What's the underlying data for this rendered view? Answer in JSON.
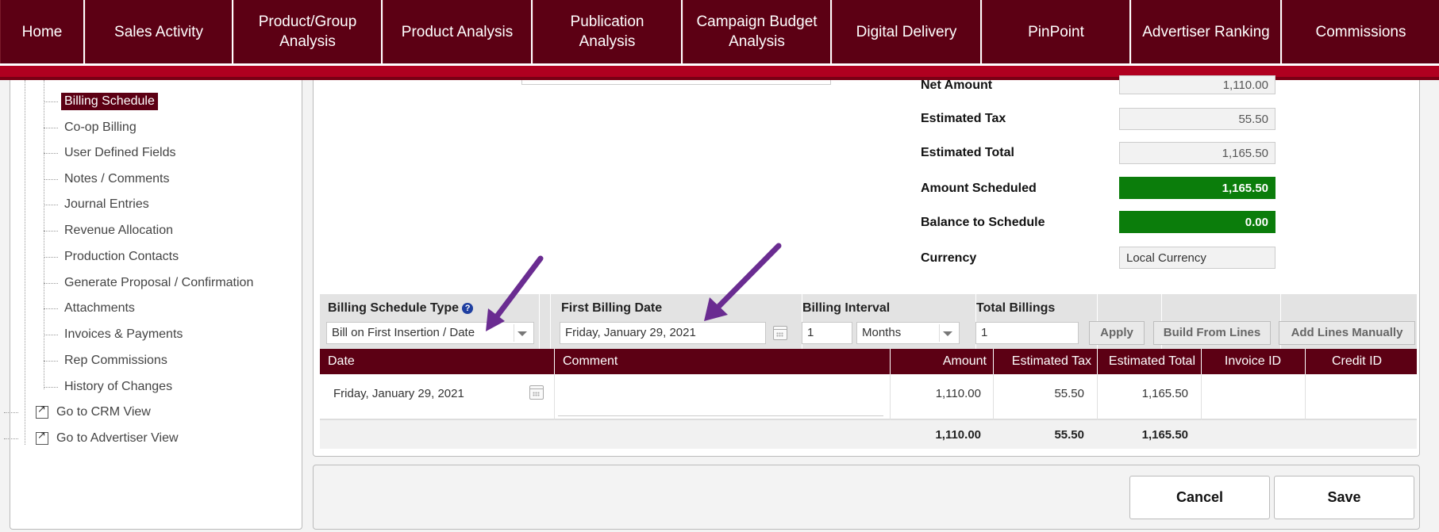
{
  "nav": {
    "tabs": [
      {
        "label": "Home"
      },
      {
        "label": "Sales Activity"
      },
      {
        "label": "Product/Group Analysis"
      },
      {
        "label": "Product Analysis"
      },
      {
        "label": "Publication Analysis"
      },
      {
        "label": "Campaign Budget Analysis"
      },
      {
        "label": "Digital Delivery"
      },
      {
        "label": "PinPoint"
      },
      {
        "label": "Advertiser Ranking"
      },
      {
        "label": "Commissions"
      }
    ]
  },
  "sidebar": {
    "items": [
      {
        "label": "Billing Schedule",
        "selected": true
      },
      {
        "label": "Co-op Billing"
      },
      {
        "label": "User Defined Fields"
      },
      {
        "label": "Notes / Comments"
      },
      {
        "label": "Journal Entries"
      },
      {
        "label": "Revenue Allocation"
      },
      {
        "label": "Production Contacts"
      },
      {
        "label": "Generate Proposal / Confirmation"
      },
      {
        "label": "Attachments"
      },
      {
        "label": "Invoices & Payments"
      },
      {
        "label": "Rep Commissions"
      },
      {
        "label": "History of Changes"
      }
    ],
    "links": [
      {
        "label": "Go to CRM View"
      },
      {
        "label": "Go to Advertiser View"
      }
    ]
  },
  "summary": {
    "net_amount": {
      "label": "Net Amount",
      "value": "1,110.00"
    },
    "estimated_tax": {
      "label": "Estimated Tax",
      "value": "55.50"
    },
    "estimated_total": {
      "label": "Estimated Total",
      "value": "1,165.50"
    },
    "amount_scheduled": {
      "label": "Amount Scheduled",
      "value": "1,165.50",
      "color": "#0b7d0b"
    },
    "balance_to_schedule": {
      "label": "Balance to Schedule",
      "value": "0.00",
      "color": "#0b7d0b"
    },
    "currency": {
      "label": "Currency",
      "value": "Local Currency"
    }
  },
  "controls": {
    "billing_schedule_type": {
      "label": "Billing Schedule Type",
      "value": "Bill on First Insertion / Date"
    },
    "first_billing_date": {
      "label": "First Billing Date",
      "value": "Friday, January 29, 2021"
    },
    "billing_interval": {
      "label": "Billing Interval",
      "value": "1",
      "unit": "Months"
    },
    "total_billings": {
      "label": "Total Billings",
      "value": "1"
    },
    "apply_label": "Apply",
    "build_from_lines_label": "Build From Lines",
    "add_lines_manually_label": "Add Lines Manually"
  },
  "grid": {
    "columns": [
      "Date",
      "Comment",
      "Amount",
      "Estimated Tax",
      "Estimated Total",
      "Invoice ID",
      "Credit ID"
    ],
    "rows": [
      {
        "date": "Friday, January 29, 2021",
        "comment": "",
        "amount": "1,110.00",
        "tax": "55.50",
        "total": "1,165.50",
        "invoice_id": "",
        "credit_id": ""
      }
    ],
    "totals": {
      "amount": "1,110.00",
      "tax": "55.50",
      "total": "1,165.50"
    }
  },
  "footer": {
    "cancel_label": "Cancel",
    "save_label": "Save"
  },
  "colors": {
    "nav_bg": "#5c0014",
    "accent_red": "#b00020",
    "green": "#0b7d0b",
    "annotation_arrow": "#6a2c91"
  },
  "icons": [
    "help-icon",
    "calendar-icon",
    "external-link-icon",
    "dropdown-arrow-icon",
    "annotation-arrow"
  ]
}
